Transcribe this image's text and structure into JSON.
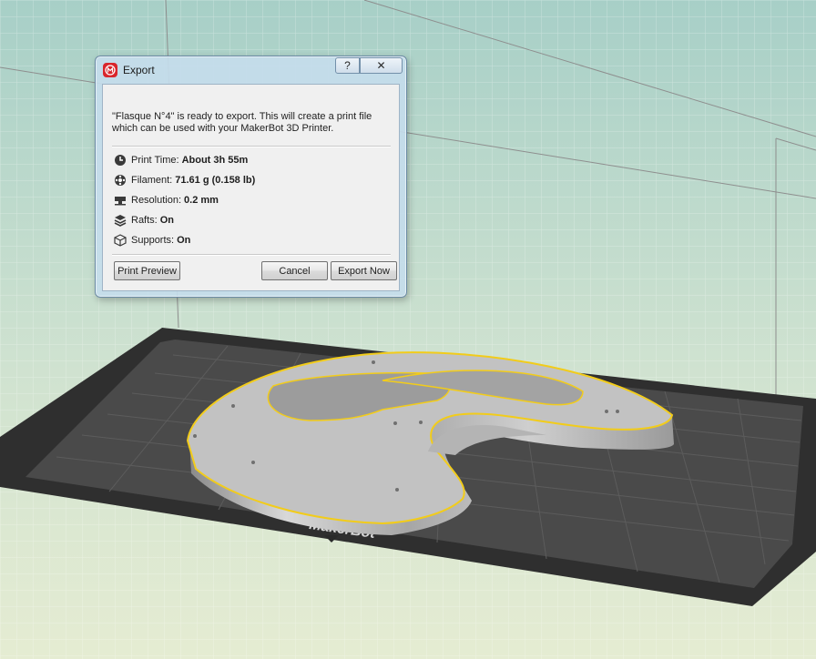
{
  "dialog": {
    "title": "Export",
    "help_glyph": "?",
    "close_glyph": "✕",
    "message": "\"Flasque N°4\" is ready to export. This will create a print file which can be used with your MakerBot 3D Printer.",
    "info": [
      {
        "icon": "clock-icon",
        "label": "Print Time:",
        "value": "About 3h 55m"
      },
      {
        "icon": "spool-icon",
        "label": "Filament:",
        "value": "71.61 g (0.158 lb)"
      },
      {
        "icon": "layer-height-icon",
        "label": "Resolution:",
        "value": "0.2 mm"
      },
      {
        "icon": "layers-icon",
        "label": "Rafts:",
        "value": "On"
      },
      {
        "icon": "cube-outline-icon",
        "label": "Supports:",
        "value": "On"
      }
    ],
    "buttons": {
      "print_preview": "Print Preview",
      "cancel": "Cancel",
      "export_now": "Export Now"
    }
  },
  "scene": {
    "brand_label": "MakerBot",
    "colors": {
      "background_top": "#a9d0c8",
      "background_bottom": "#e2ebd2",
      "build_plate": "#474747",
      "plate_border": "#2e2e2e",
      "part": "#c2c2c2",
      "selection_outline": "#f2cc1a",
      "app_accent": "#d9262c"
    }
  }
}
